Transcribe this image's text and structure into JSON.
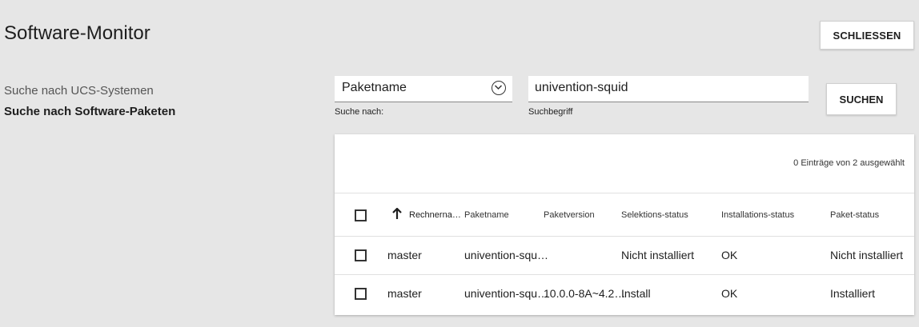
{
  "app": {
    "title": "Software-Monitor",
    "close_label": "SCHLIESSEN"
  },
  "nav": {
    "items": [
      "Suche nach UCS-Systemen",
      "Suche nach Software-Paketen"
    ],
    "active_index": 1
  },
  "search": {
    "field_select_value": "Paketname",
    "field_select_label": "Suche nach:",
    "term_value": "univention-squid",
    "term_label": "Suchbegriff",
    "submit_label": "SUCHEN"
  },
  "grid": {
    "status": "0 Einträge von 2 ausgewählt",
    "columns": [
      "Rechnerna…",
      "Paketname",
      "Paketversion",
      "Selektions-status",
      "Installations-status",
      "Paket-status"
    ],
    "sort_column": "Rechnerna…",
    "sort_direction": "ascending",
    "rows": [
      [
        "master",
        "univention-squ…",
        "",
        "Nicht installiert",
        "OK",
        "Nicht installiert"
      ],
      [
        "master",
        "univention-squ…",
        "10.0.0-8A~4.2…",
        "Install",
        "OK",
        "Installiert"
      ]
    ]
  }
}
